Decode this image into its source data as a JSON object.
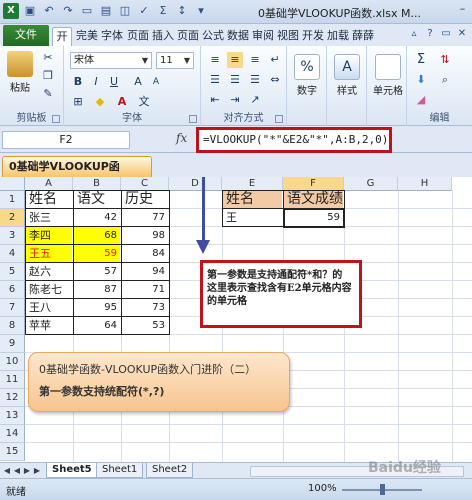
{
  "window": {
    "title": "0基础学VLOOKUP函数.xlsx M..."
  },
  "ribbon_tabs": {
    "file": "文件",
    "tabs": [
      "开始",
      "完美",
      "字体",
      "页面",
      "插入",
      "页面",
      "公式",
      "数据",
      "审阅",
      "视图",
      "开发",
      "加载",
      "薛薛"
    ]
  },
  "ribbon": {
    "clipboard_label": "剪贴板",
    "paste_label": "粘贴",
    "font_label": "字体",
    "font_name": "宋体",
    "font_size": "11",
    "align_label": "对齐方式",
    "number_label": "数字",
    "styles_label": "样式",
    "cells_label": "单元格",
    "edit_label": "编辑"
  },
  "formula_bar": {
    "name_box": "F2",
    "fx": "fx",
    "formula": "=VLOOKUP(\"*\"&E2&\"*\",A:B,2,0)"
  },
  "workbook_tab": "0基础学VLOOKUP函数.xlsx",
  "columns": [
    "A",
    "B",
    "C",
    "D",
    "E",
    "F",
    "G",
    "H"
  ],
  "rows": [
    "1",
    "2",
    "3",
    "4",
    "5",
    "6",
    "7",
    "8",
    "9",
    "10",
    "11",
    "12",
    "13",
    "14",
    "15"
  ],
  "table_left": {
    "headers": [
      "姓名",
      "语文",
      "历史"
    ],
    "rows": [
      {
        "name": "张三",
        "chinese": "42",
        "history": "77"
      },
      {
        "name": "李四",
        "chinese": "68",
        "history": "98"
      },
      {
        "name": "王五",
        "chinese": "59",
        "history": "84"
      },
      {
        "name": "赵六",
        "chinese": "57",
        "history": "94"
      },
      {
        "name": "陈老七",
        "chinese": "87",
        "history": "71"
      },
      {
        "name": "王八",
        "chinese": "95",
        "history": "73"
      },
      {
        "name": "苹苹",
        "chinese": "64",
        "history": "53"
      }
    ]
  },
  "table_right": {
    "headers": [
      "姓名",
      "语文成绩"
    ],
    "name": "王",
    "score": "59"
  },
  "callout": {
    "text": "第一参数是支持通配符*和？的\n这里表示查找含有E2单元格内容的单元格"
  },
  "note": {
    "line1": "0基础学函数-VLOOKUP函数入门进阶（二）",
    "line2": "第一参数支持统配符(*,?)"
  },
  "sheet_tabs": [
    "Sheet5",
    "Sheet1",
    "Sheet2"
  ],
  "status": {
    "ready": "就绪",
    "zoom": "100%"
  },
  "watermark": "Baidu经验"
}
